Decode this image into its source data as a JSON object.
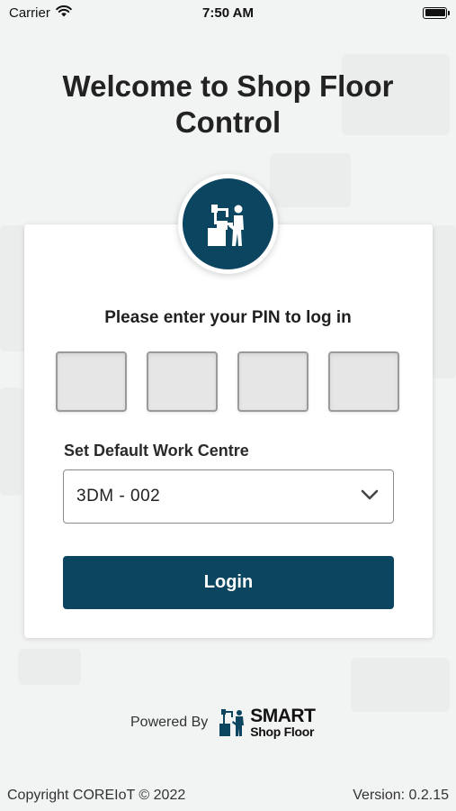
{
  "status_bar": {
    "carrier": "Carrier",
    "time": "7:50 AM",
    "icons": [
      "wifi-icon",
      "battery-icon"
    ]
  },
  "title_line1": "Welcome to Shop Floor",
  "title_line2": "Control",
  "logo": {
    "icon": "worker-machine-icon",
    "color": "#0b4560"
  },
  "pin": {
    "prompt": "Please enter your PIN to log in",
    "boxes": [
      "",
      "",
      "",
      ""
    ]
  },
  "work_centre": {
    "label": "Set Default Work Centre",
    "selected": "3DM - 002",
    "icon": "chevron-down-icon"
  },
  "login": {
    "label": "Login",
    "color": "#0b4560"
  },
  "powered_by": {
    "label": "Powered By",
    "brand_line1": "SMART",
    "brand_line2": "Shop Floor"
  },
  "footer": {
    "copyright": "Copyright COREIoT © 2022",
    "version": "Version: 0.2.15"
  }
}
